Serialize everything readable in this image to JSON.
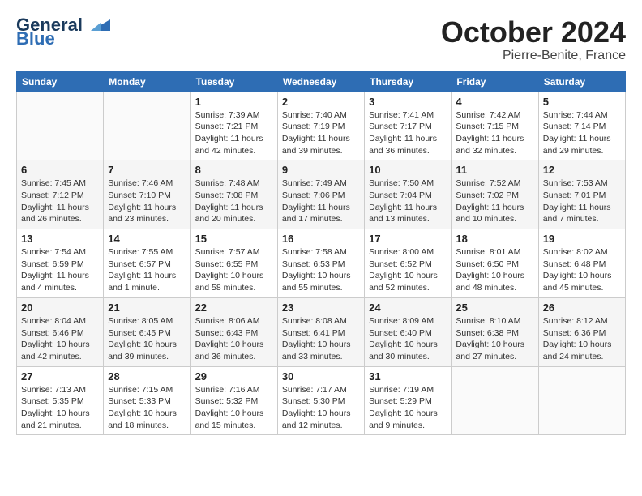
{
  "header": {
    "logo_line1": "General",
    "logo_line2": "Blue",
    "month": "October 2024",
    "location": "Pierre-Benite, France"
  },
  "weekdays": [
    "Sunday",
    "Monday",
    "Tuesday",
    "Wednesday",
    "Thursday",
    "Friday",
    "Saturday"
  ],
  "weeks": [
    [
      {
        "day": "",
        "detail": ""
      },
      {
        "day": "",
        "detail": ""
      },
      {
        "day": "1",
        "detail": "Sunrise: 7:39 AM\nSunset: 7:21 PM\nDaylight: 11 hours and 42 minutes."
      },
      {
        "day": "2",
        "detail": "Sunrise: 7:40 AM\nSunset: 7:19 PM\nDaylight: 11 hours and 39 minutes."
      },
      {
        "day": "3",
        "detail": "Sunrise: 7:41 AM\nSunset: 7:17 PM\nDaylight: 11 hours and 36 minutes."
      },
      {
        "day": "4",
        "detail": "Sunrise: 7:42 AM\nSunset: 7:15 PM\nDaylight: 11 hours and 32 minutes."
      },
      {
        "day": "5",
        "detail": "Sunrise: 7:44 AM\nSunset: 7:14 PM\nDaylight: 11 hours and 29 minutes."
      }
    ],
    [
      {
        "day": "6",
        "detail": "Sunrise: 7:45 AM\nSunset: 7:12 PM\nDaylight: 11 hours and 26 minutes."
      },
      {
        "day": "7",
        "detail": "Sunrise: 7:46 AM\nSunset: 7:10 PM\nDaylight: 11 hours and 23 minutes."
      },
      {
        "day": "8",
        "detail": "Sunrise: 7:48 AM\nSunset: 7:08 PM\nDaylight: 11 hours and 20 minutes."
      },
      {
        "day": "9",
        "detail": "Sunrise: 7:49 AM\nSunset: 7:06 PM\nDaylight: 11 hours and 17 minutes."
      },
      {
        "day": "10",
        "detail": "Sunrise: 7:50 AM\nSunset: 7:04 PM\nDaylight: 11 hours and 13 minutes."
      },
      {
        "day": "11",
        "detail": "Sunrise: 7:52 AM\nSunset: 7:02 PM\nDaylight: 11 hours and 10 minutes."
      },
      {
        "day": "12",
        "detail": "Sunrise: 7:53 AM\nSunset: 7:01 PM\nDaylight: 11 hours and 7 minutes."
      }
    ],
    [
      {
        "day": "13",
        "detail": "Sunrise: 7:54 AM\nSunset: 6:59 PM\nDaylight: 11 hours and 4 minutes."
      },
      {
        "day": "14",
        "detail": "Sunrise: 7:55 AM\nSunset: 6:57 PM\nDaylight: 11 hours and 1 minute."
      },
      {
        "day": "15",
        "detail": "Sunrise: 7:57 AM\nSunset: 6:55 PM\nDaylight: 10 hours and 58 minutes."
      },
      {
        "day": "16",
        "detail": "Sunrise: 7:58 AM\nSunset: 6:53 PM\nDaylight: 10 hours and 55 minutes."
      },
      {
        "day": "17",
        "detail": "Sunrise: 8:00 AM\nSunset: 6:52 PM\nDaylight: 10 hours and 52 minutes."
      },
      {
        "day": "18",
        "detail": "Sunrise: 8:01 AM\nSunset: 6:50 PM\nDaylight: 10 hours and 48 minutes."
      },
      {
        "day": "19",
        "detail": "Sunrise: 8:02 AM\nSunset: 6:48 PM\nDaylight: 10 hours and 45 minutes."
      }
    ],
    [
      {
        "day": "20",
        "detail": "Sunrise: 8:04 AM\nSunset: 6:46 PM\nDaylight: 10 hours and 42 minutes."
      },
      {
        "day": "21",
        "detail": "Sunrise: 8:05 AM\nSunset: 6:45 PM\nDaylight: 10 hours and 39 minutes."
      },
      {
        "day": "22",
        "detail": "Sunrise: 8:06 AM\nSunset: 6:43 PM\nDaylight: 10 hours and 36 minutes."
      },
      {
        "day": "23",
        "detail": "Sunrise: 8:08 AM\nSunset: 6:41 PM\nDaylight: 10 hours and 33 minutes."
      },
      {
        "day": "24",
        "detail": "Sunrise: 8:09 AM\nSunset: 6:40 PM\nDaylight: 10 hours and 30 minutes."
      },
      {
        "day": "25",
        "detail": "Sunrise: 8:10 AM\nSunset: 6:38 PM\nDaylight: 10 hours and 27 minutes."
      },
      {
        "day": "26",
        "detail": "Sunrise: 8:12 AM\nSunset: 6:36 PM\nDaylight: 10 hours and 24 minutes."
      }
    ],
    [
      {
        "day": "27",
        "detail": "Sunrise: 7:13 AM\nSunset: 5:35 PM\nDaylight: 10 hours and 21 minutes."
      },
      {
        "day": "28",
        "detail": "Sunrise: 7:15 AM\nSunset: 5:33 PM\nDaylight: 10 hours and 18 minutes."
      },
      {
        "day": "29",
        "detail": "Sunrise: 7:16 AM\nSunset: 5:32 PM\nDaylight: 10 hours and 15 minutes."
      },
      {
        "day": "30",
        "detail": "Sunrise: 7:17 AM\nSunset: 5:30 PM\nDaylight: 10 hours and 12 minutes."
      },
      {
        "day": "31",
        "detail": "Sunrise: 7:19 AM\nSunset: 5:29 PM\nDaylight: 10 hours and 9 minutes."
      },
      {
        "day": "",
        "detail": ""
      },
      {
        "day": "",
        "detail": ""
      }
    ]
  ]
}
